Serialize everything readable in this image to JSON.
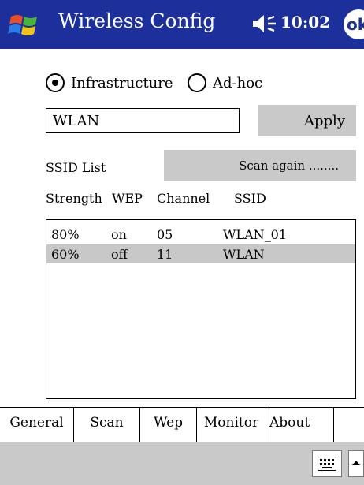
{
  "titlebar": {
    "title": "Wireless Config",
    "time": "10:02",
    "ok_label": "ok",
    "accent_color": "#1c2f9a"
  },
  "mode": {
    "options": [
      {
        "label": "Infrastructure",
        "selected": true
      },
      {
        "label": "Ad-hoc",
        "selected": false
      }
    ]
  },
  "ssid_field": {
    "value": "WLAN"
  },
  "buttons": {
    "apply_label": "Apply",
    "scan_label": "Scan again ........"
  },
  "ssid_list": {
    "label": "SSID List",
    "columns": [
      "Strength",
      "WEP",
      "Channel",
      "SSID"
    ],
    "rows": [
      {
        "strength": "80%",
        "wep": "on",
        "channel": "05",
        "ssid": "WLAN_01",
        "selected": false
      },
      {
        "strength": "60%",
        "wep": "off",
        "channel": "11",
        "ssid": "WLAN",
        "selected": true
      }
    ]
  },
  "tabs": [
    "General",
    "Scan",
    "Wep",
    "Monitor",
    "About"
  ],
  "icons": {
    "start": "windows-flag-icon",
    "volume": "speaker-icon",
    "keyboard": "keyboard-icon",
    "sip_arrow": "up-arrow-icon"
  }
}
